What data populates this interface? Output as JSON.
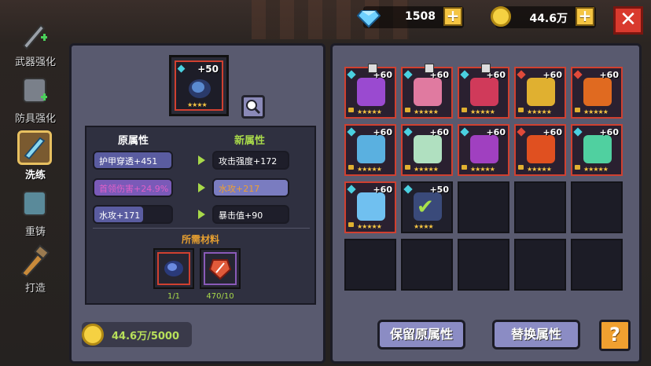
{
  "top": {
    "gems": "1508",
    "gold": "44.6万"
  },
  "sidebar": {
    "items": [
      {
        "label": "武器强化"
      },
      {
        "label": "防具强化"
      },
      {
        "label": "洗练"
      },
      {
        "label": "重铸"
      },
      {
        "label": "打造"
      }
    ]
  },
  "item": {
    "level": "+50",
    "stars": "★★★★"
  },
  "attrs": {
    "old_header": "原属性",
    "new_header": "新属性",
    "old": [
      "护甲穿透+451",
      "首领伤害+24.9%",
      "水攻+171"
    ],
    "new": [
      "攻击强度+172",
      "水攻+217",
      "暴击值+90"
    ]
  },
  "materials": {
    "label": "所需材料",
    "counts": [
      "1/1",
      "470/10"
    ]
  },
  "gold_cost": "44.6万/5000",
  "grid": {
    "slots": [
      {
        "level": "+60",
        "stars": "★★★★★",
        "icon": "purple-armor",
        "gem": "#4ad0e0"
      },
      {
        "level": "+60",
        "stars": "★★★★★",
        "icon": "pink-armor",
        "gem": "#4ad0e0"
      },
      {
        "level": "+60",
        "stars": "★★★★★",
        "icon": "red-armor",
        "gem": "#4ad0e0"
      },
      {
        "level": "+60",
        "stars": "★★★★★",
        "icon": "spear",
        "gem": "#e04a3a"
      },
      {
        "level": "+60",
        "stars": "★★★★★",
        "icon": "fire-staff",
        "gem": "#e04a3a"
      },
      {
        "level": "+60",
        "stars": "★★★★★",
        "icon": "ice-bow",
        "gem": "#4ad0e0"
      },
      {
        "level": "+60",
        "stars": "★★★★★",
        "icon": "blade",
        "gem": "#4ad0e0"
      },
      {
        "level": "+60",
        "stars": "★★★★★",
        "icon": "crossbow",
        "gem": "#4ad0e0"
      },
      {
        "level": "+60",
        "stars": "★★★★★",
        "icon": "flame-lantern",
        "gem": "#e04a3a"
      },
      {
        "level": "+60",
        "stars": "★★★★★",
        "icon": "green-sword",
        "gem": "#4ad0e0"
      },
      {
        "level": "+60",
        "stars": "★★★★★",
        "icon": "ice-hammer",
        "gem": "#4ad0e0"
      },
      {
        "level": "+50",
        "stars": "★★★★",
        "icon": "selected-check",
        "gem": "#4ad0e0"
      }
    ]
  },
  "buttons": {
    "keep": "保留原属性",
    "replace": "替换属性",
    "help": "?"
  }
}
